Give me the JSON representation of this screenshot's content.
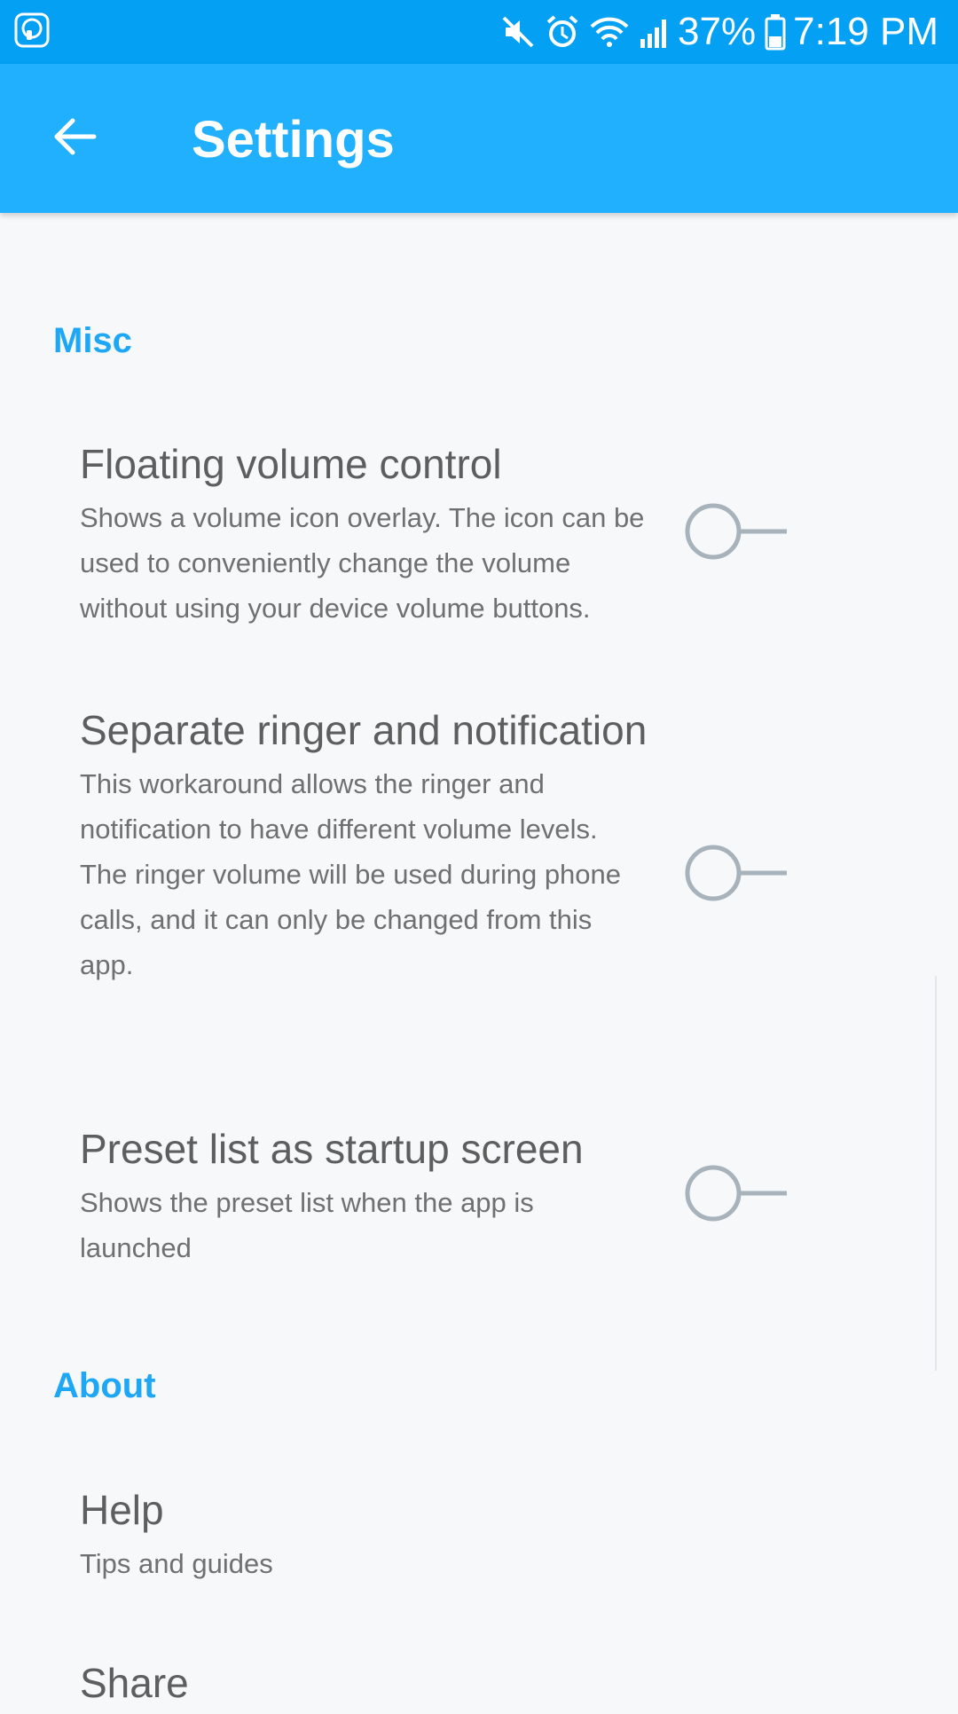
{
  "status_bar": {
    "battery": "37%",
    "time": "7:19 PM",
    "icons": [
      "mute-icon",
      "alarm-icon",
      "wifi-icon",
      "signal-icon",
      "battery-icon"
    ]
  },
  "app_bar": {
    "back_icon": "arrow-back-icon",
    "title": "Settings"
  },
  "sections": {
    "misc": {
      "header": "Misc",
      "items": [
        {
          "title": "Floating volume control",
          "summary": "Shows a volume icon overlay. The icon can be used to conveniently change the volume without using your device volume buttons.",
          "enabled": false
        },
        {
          "title": "Separate ringer and notification",
          "summary": "This workaround allows the ringer and notification to have different volume levels. The ringer volume will be used during phone calls, and it can only be changed from this app.",
          "enabled": false
        },
        {
          "title": "Preset list as startup screen",
          "summary": "Shows the preset list when the app is launched",
          "enabled": false
        }
      ]
    },
    "about": {
      "header": "About",
      "items": [
        {
          "title": "Help",
          "summary": "Tips and guides"
        },
        {
          "title": "Share"
        }
      ]
    }
  },
  "colors": {
    "status_bar": "#03a0f4",
    "app_bar": "#21b0fd",
    "accent": "#1ea7f5",
    "switch_off": "#a7b2bb",
    "background": "#f6f8fa"
  }
}
